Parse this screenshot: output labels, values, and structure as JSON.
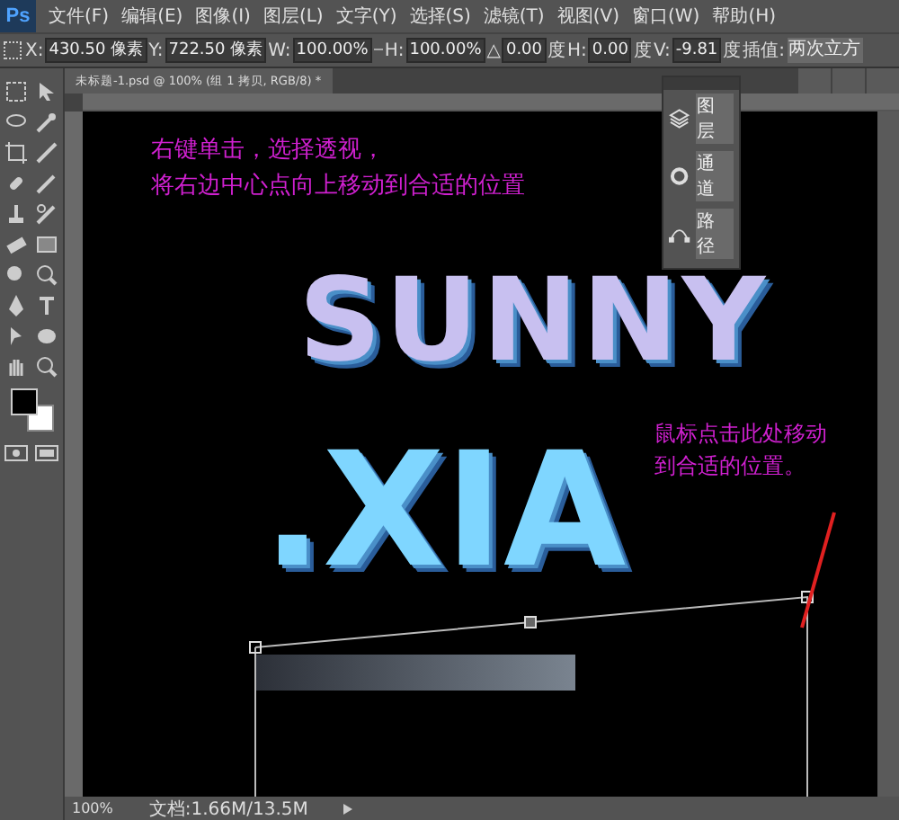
{
  "app": {
    "logo": "Ps",
    "menu": [
      "文件(F)",
      "编辑(E)",
      "图像(I)",
      "图层(L)",
      "文字(Y)",
      "选择(S)",
      "滤镜(T)",
      "视图(V)",
      "窗口(W)",
      "帮助(H)"
    ]
  },
  "options_bar": {
    "fields": [
      {
        "label": "X:",
        "value": "430.50 像素"
      },
      {
        "label": "Y:",
        "value": "722.50 像素"
      },
      {
        "label": "W:",
        "value": "100.00%"
      },
      {
        "label": "H:",
        "value": "100.00%"
      },
      {
        "label": "△",
        "value": "0.00",
        "unit": "度"
      },
      {
        "label": "H:",
        "value": "0.00",
        "unit": "度"
      },
      {
        "label": "V:",
        "value": "-9.81",
        "unit": "度"
      }
    ],
    "interpolation": {
      "label": "插值:",
      "value": "两次立方"
    }
  },
  "document": {
    "tab": "未标题-1.psd @ 100% (组 1 拷贝, RGB/8) *",
    "annotations": [
      {
        "lines": [
          "右键单击，选择透视，",
          "将右边中心点向上移动到合适的位置"
        ]
      },
      {
        "lines": [
          "鼠标点击此处移动",
          "到合适的位置。"
        ]
      }
    ],
    "artwork": [
      "SUNNY",
      ".XIA"
    ]
  },
  "panel": {
    "items": [
      "图层",
      "通道",
      "路径"
    ]
  },
  "status_bar": {
    "zoom": "100%",
    "doc_info": "文档:1.66M/13.5M"
  }
}
